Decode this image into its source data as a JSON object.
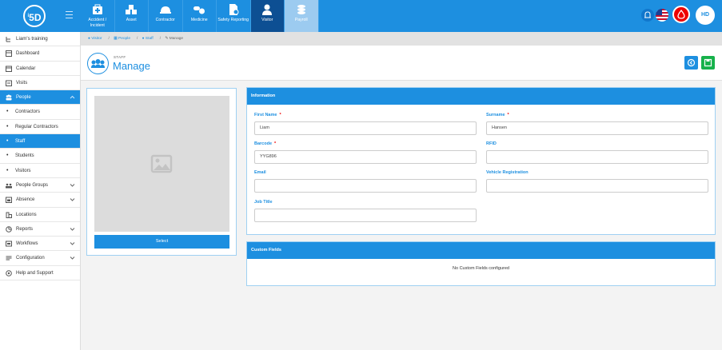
{
  "brand": {
    "logo_text": "5D",
    "logo_sup": "i"
  },
  "modules": [
    {
      "label": "Accident / Incident",
      "icon": "first-aid-kit-icon"
    },
    {
      "label": "Asset",
      "icon": "asset-boxes-icon"
    },
    {
      "label": "Contractor",
      "icon": "hard-hat-icon"
    },
    {
      "label": "Medicine",
      "icon": "pills-icon"
    },
    {
      "label": "Safety Reporting",
      "icon": "safety-report-icon"
    },
    {
      "label": "Visitor",
      "icon": "visitor-person-icon"
    },
    {
      "label": "Payroll",
      "icon": "coins-icon"
    }
  ],
  "user": {
    "initials": "HD"
  },
  "sidebar": {
    "items": [
      {
        "label": "Liam's training",
        "icon": "user-tree-icon"
      },
      {
        "label": "Dashboard",
        "icon": "dashboard-icon"
      },
      {
        "label": "Calendar",
        "icon": "calendar-icon"
      },
      {
        "label": "Visits",
        "icon": "visits-icon"
      },
      {
        "label": "People",
        "icon": "people-icon"
      },
      {
        "label": "Contractors"
      },
      {
        "label": "Regular Contractors"
      },
      {
        "label": "Staff"
      },
      {
        "label": "Students"
      },
      {
        "label": "Visitors"
      },
      {
        "label": "People Groups",
        "icon": "people-groups-icon"
      },
      {
        "label": "Absence",
        "icon": "absence-icon"
      },
      {
        "label": "Locations",
        "icon": "locations-icon"
      },
      {
        "label": "Reports",
        "icon": "reports-icon"
      },
      {
        "label": "Workflows",
        "icon": "workflows-icon"
      },
      {
        "label": "Configuration",
        "icon": "configuration-icon"
      },
      {
        "label": "Help and Support",
        "icon": "help-icon"
      }
    ]
  },
  "breadcrumb": {
    "items": [
      "Visitor",
      "People",
      "Staff",
      "Manage"
    ]
  },
  "header": {
    "small": "STAFF",
    "title": "Manage"
  },
  "photo": {
    "select_label": "Select"
  },
  "info": {
    "title": "Information",
    "first_name": {
      "label": "First Name",
      "value": "Liam"
    },
    "surname": {
      "label": "Surname",
      "value": "Hansen"
    },
    "barcode": {
      "label": "Barcode",
      "value": "YYG896"
    },
    "rfid": {
      "label": "RFID",
      "value": ""
    },
    "email": {
      "label": "Email",
      "value": ""
    },
    "vehicle": {
      "label": "Vehicle Registration",
      "value": ""
    },
    "job_title": {
      "label": "Job Title",
      "value": ""
    },
    "required_mark": "*"
  },
  "custom_fields": {
    "title": "Custom Fields",
    "message": "No Custom Fields configured"
  },
  "colors": {
    "primary": "#1d8fe0",
    "visitor_active": "#0d4f93",
    "save": "#16b14b",
    "required": "#ee0000"
  }
}
